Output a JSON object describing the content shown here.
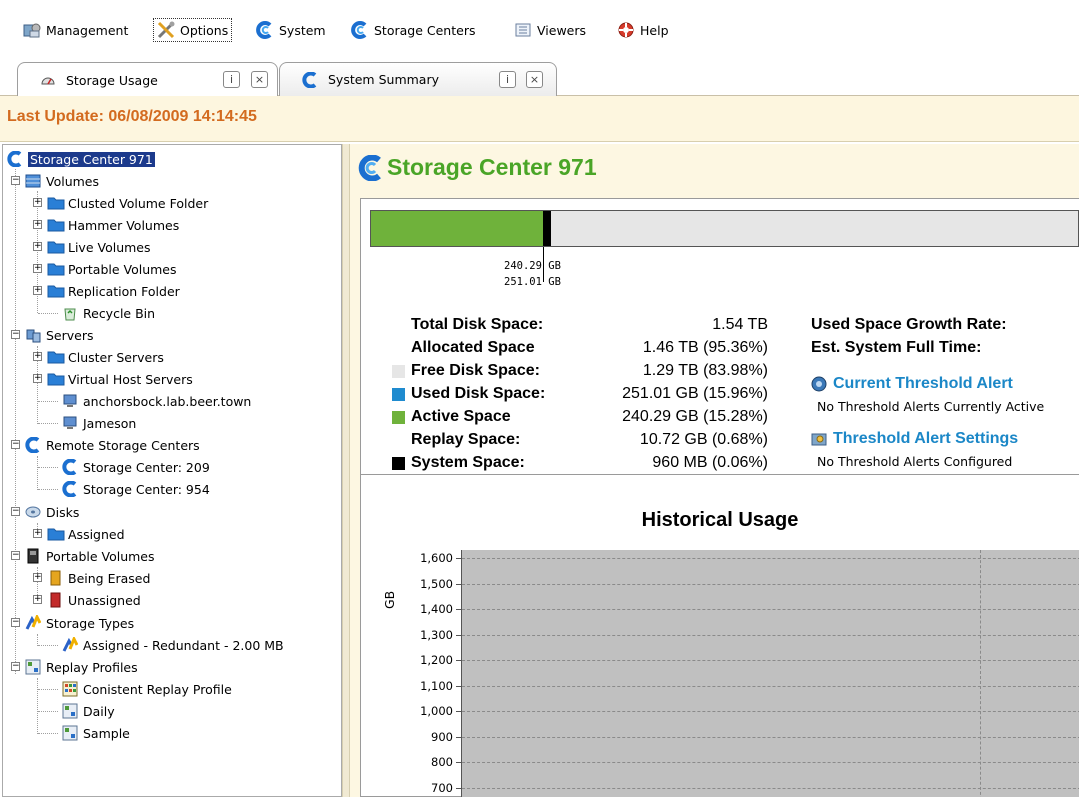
{
  "menu": [
    {
      "label": "Management",
      "icon": "management-icon"
    },
    {
      "label": "Options",
      "icon": "options-icon"
    },
    {
      "label": "System",
      "icon": "system-icon"
    },
    {
      "label": "Storage Centers",
      "icon": "storage-centers-icon"
    },
    {
      "label": "Viewers",
      "icon": "viewers-icon"
    },
    {
      "label": "Help",
      "icon": "help-icon"
    }
  ],
  "tabs": [
    {
      "label": "Storage Usage",
      "active": true
    },
    {
      "label": "System Summary",
      "active": false
    }
  ],
  "tab_buttons": {
    "info": "i",
    "close": "×"
  },
  "last_update": "Last Update: 06/08/2009 14:14:45",
  "tree": {
    "root": "Storage Center 971",
    "volumes": "Volumes",
    "volume_items": [
      "Clusted Volume Folder",
      "Hammer Volumes",
      "Live Volumes",
      "Portable Volumes",
      "Replication Folder",
      "Recycle Bin"
    ],
    "servers": "Servers",
    "server_items": [
      "Cluster Servers",
      "Virtual Host Servers",
      "anchorsbock.lab.beer.town",
      "Jameson"
    ],
    "remote": "Remote Storage Centers",
    "remote_items": [
      "Storage Center: 209",
      "Storage Center: 954"
    ],
    "disks": "Disks",
    "disk_items": [
      "Assigned"
    ],
    "portable": "Portable Volumes",
    "portable_items": [
      "Being Erased",
      "Unassigned"
    ],
    "storage_types": "Storage Types",
    "storage_type_items": [
      "Assigned - Redundant - 2.00 MB"
    ],
    "replay_profiles": "Replay Profiles",
    "replay_items": [
      "Conistent Replay Profile",
      "Daily",
      "Sample"
    ]
  },
  "content": {
    "title": "Storage Center 971",
    "bar": {
      "active_fraction": 0.2436,
      "used_fraction": 0.2545,
      "label_active": "240.29 GB",
      "label_used": "251.01 GB"
    },
    "stats": [
      {
        "label": "Total Disk Space:",
        "value": "1.54 TB",
        "swatch": ""
      },
      {
        "label": "Allocated Space",
        "value": "1.46 TB (95.36%)",
        "swatch": ""
      },
      {
        "label": "Free Disk Space:",
        "value": "1.29 TB (83.98%)",
        "swatch": "#e6e6e6"
      },
      {
        "label": "Used Disk Space:",
        "value": "251.01 GB (15.96%)",
        "swatch": "#1f8bcf"
      },
      {
        "label": "Active Space",
        "value": "240.29 GB (15.28%)",
        "swatch": "#6fb23b"
      },
      {
        "label": "Replay Space:",
        "value": "10.72 GB (0.68%)",
        "swatch": ""
      },
      {
        "label": "System Space:",
        "value": "960 MB (0.06%)",
        "swatch": "#000000"
      }
    ],
    "growth_rate": "Used Space Growth Rate:",
    "full_time": "Est. System Full Time:",
    "current_alerts": "Current Threshold Alert",
    "current_alerts_sub": "No Threshold Alerts Currently Active",
    "alert_settings": "Threshold Alert Settings",
    "alert_settings_sub": "No Threshold Alerts Configured"
  },
  "chart_data": {
    "type": "area",
    "title": "Historical Usage",
    "ylabel": "GB",
    "xlabel": "",
    "yticks": [
      "1,600",
      "1,500",
      "1,400",
      "1,300",
      "1,200",
      "1,100",
      "1,000",
      "900",
      "800",
      "700"
    ],
    "ylim": [
      700,
      1600
    ],
    "grid": true,
    "series": []
  }
}
